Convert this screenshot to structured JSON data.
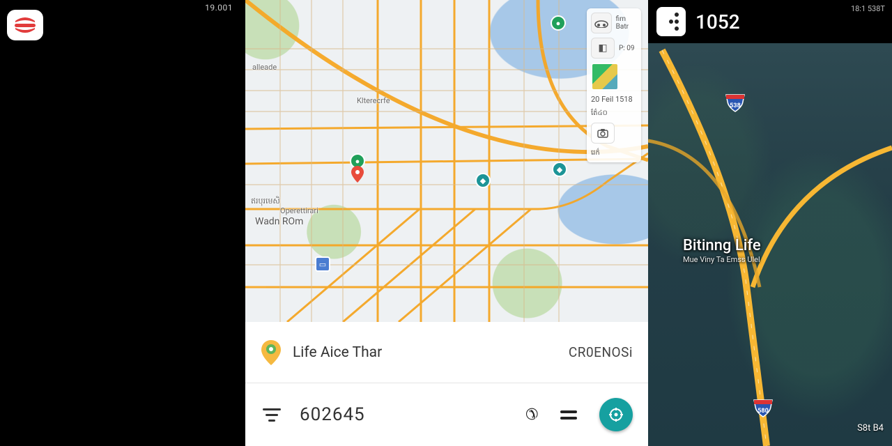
{
  "left_panel": {
    "status_time": "19.001",
    "app_icon": "burger-icon"
  },
  "center_map": {
    "toolbar": {
      "row1_label": "fim Batr",
      "row2_label": "P: 09",
      "date_label": "20 Feil 1518",
      "poi1": "ត៌ែ៤០",
      "poi2": "រេក៌",
      "camera_label": "camera"
    },
    "labels": {
      "l1": "ឥរបុរមេសិ",
      "l2": "Operettirari",
      "l3": "Wadn ROm",
      "l4": "Klterecrfe",
      "l5": "alleade"
    },
    "bottom_sheet": {
      "place_name": "Life Aice Thar",
      "action_label": "CR0ENOSi",
      "code_value": "602645"
    }
  },
  "right_map": {
    "status_time": "18:1 538T",
    "clock": "1052",
    "overlay_title": "Bitinng Life",
    "overlay_sub": "Mue Viny Ta Emss Ulel",
    "exit_label": "S8t B4",
    "shield1": "580",
    "shield2": "538"
  }
}
